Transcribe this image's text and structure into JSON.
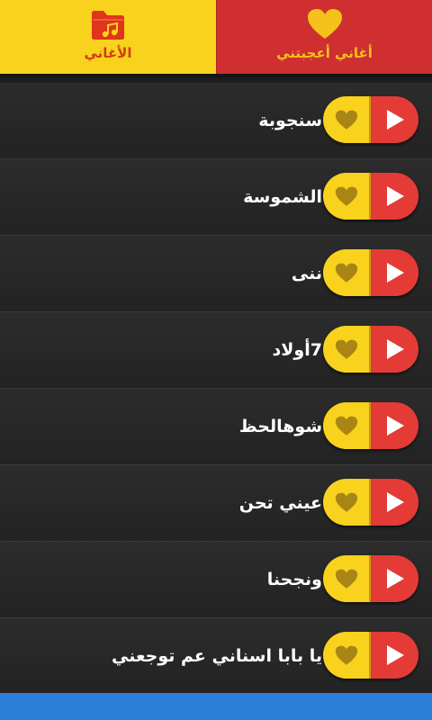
{
  "tabs": {
    "songs": {
      "label": "الأغاني",
      "icon": "music-folder-icon"
    },
    "favorites": {
      "label": "أغاني أعجبتني",
      "icon": "heart-icon"
    }
  },
  "songs": [
    {
      "title": "سنجوبة"
    },
    {
      "title": "الشموسة"
    },
    {
      "title": "ننى"
    },
    {
      "title": "7أولاد"
    },
    {
      "title": "شوهالحظ"
    },
    {
      "title": "عيني تحن"
    },
    {
      "title": "ونجحنا"
    },
    {
      "title": "يا بابا اسناني عم توجعني"
    }
  ],
  "colors": {
    "tab_active": "#f8d21c",
    "tab_inactive": "#cf2f30",
    "play": "#e43b36",
    "favorite": "#f8d21c",
    "heart": "#a98516",
    "bottom_bar": "#2d7ed9"
  }
}
